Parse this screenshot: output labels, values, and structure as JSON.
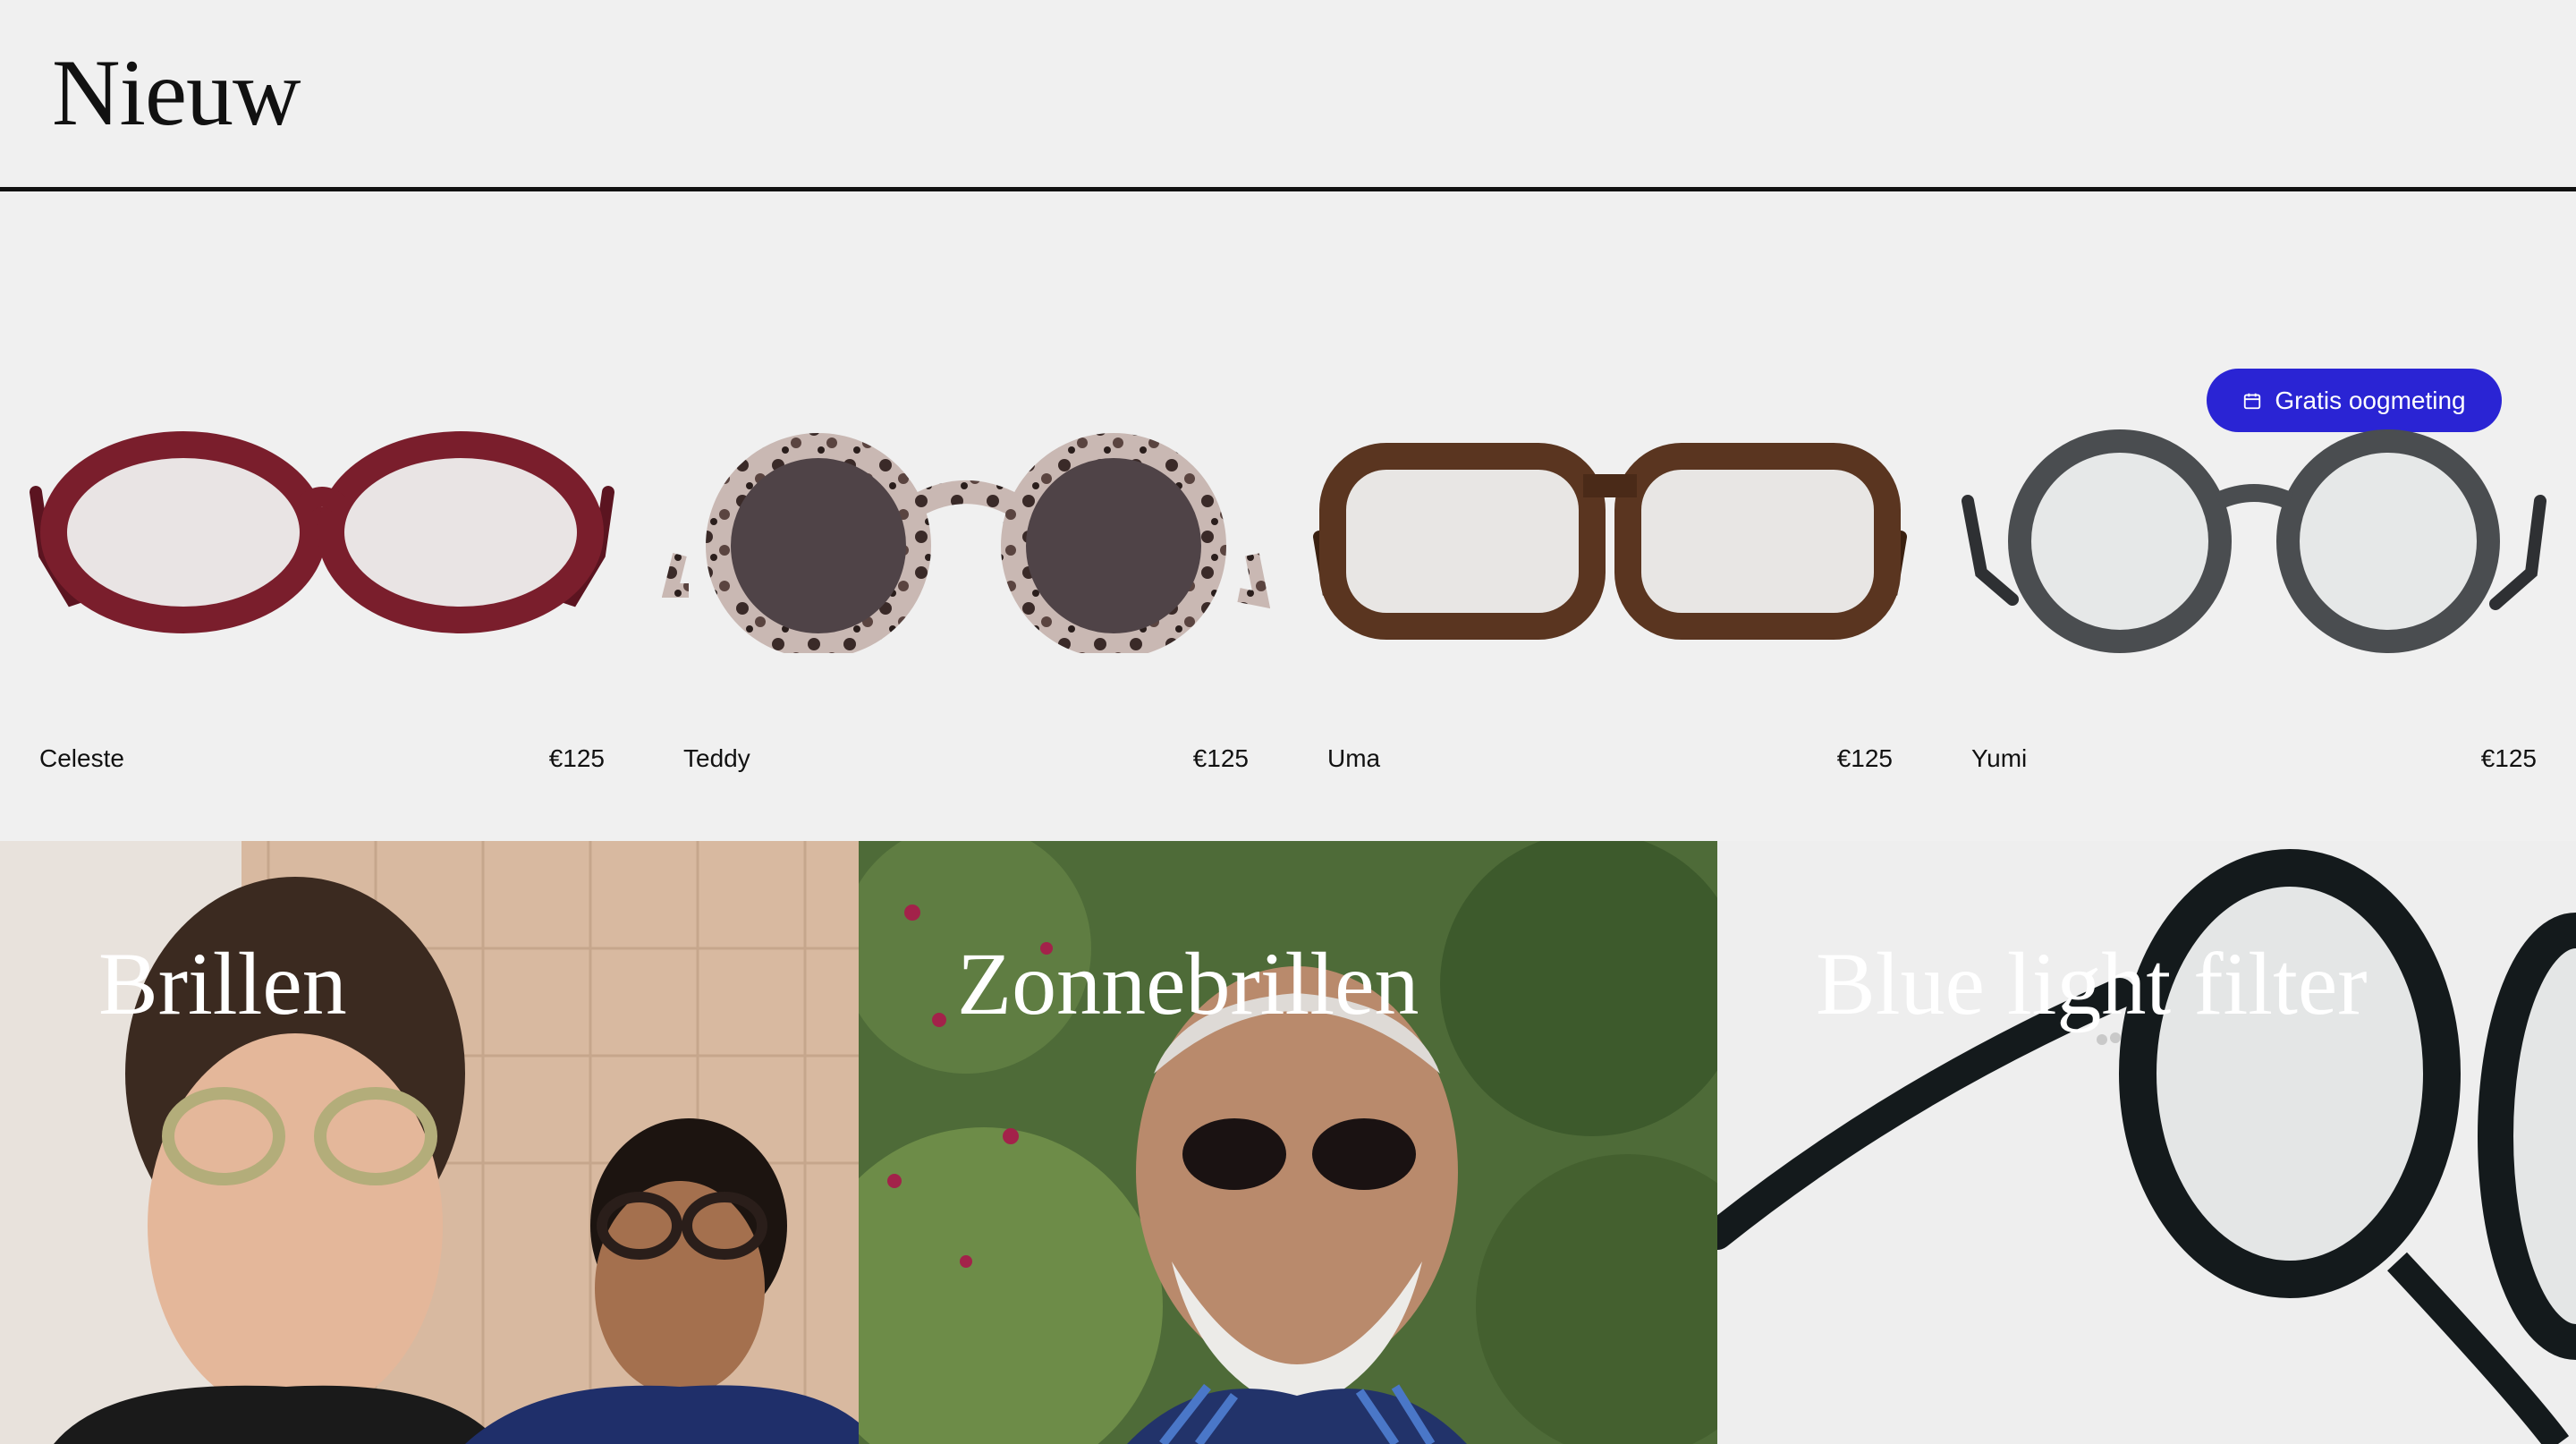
{
  "header": {
    "title": "Nieuw"
  },
  "cta": {
    "label": "Gratis oogmeting",
    "icon": "calendar-icon",
    "color": "#2a24d4"
  },
  "products": [
    {
      "name": "Celeste",
      "price": "€125",
      "frame_color": "#7a1e2c"
    },
    {
      "name": "Teddy",
      "price": "€125",
      "frame_color": "#b9a9a4"
    },
    {
      "name": "Uma",
      "price": "€125",
      "frame_color": "#5a3520"
    },
    {
      "name": "Yumi",
      "price": "€125",
      "frame_color": "#4a4d50"
    }
  ],
  "categories": [
    {
      "label": "Brillen"
    },
    {
      "label": "Zonnebrillen"
    },
    {
      "label": "Blue light filter"
    }
  ]
}
